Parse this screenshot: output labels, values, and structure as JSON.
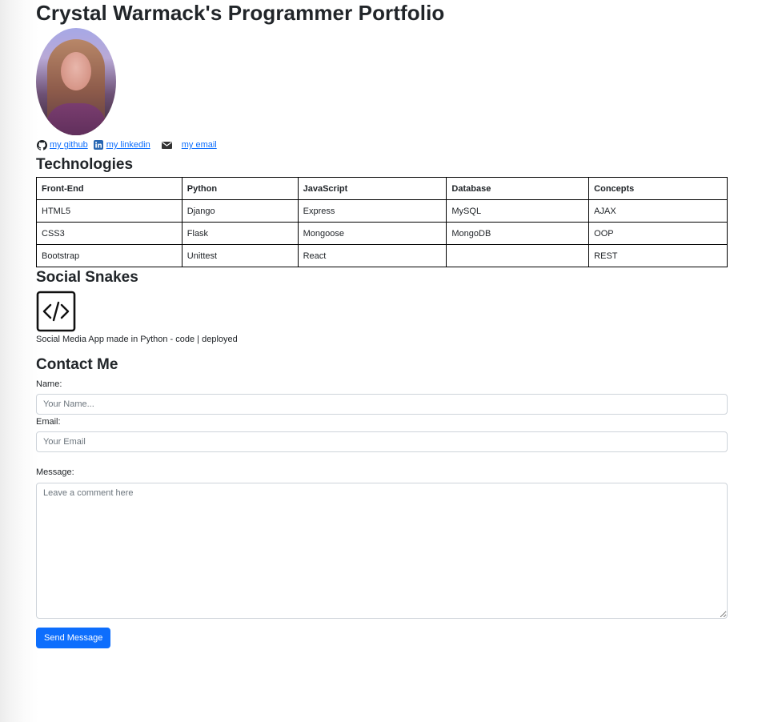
{
  "page": {
    "title": "Crystal Warmack's Programmer Portfolio"
  },
  "links": {
    "github": "my github",
    "linkedin": "my linkedin",
    "email": "my email"
  },
  "technologies": {
    "heading": "Technologies",
    "columns": [
      "Front-End",
      "Python",
      "JavaScript",
      "Database",
      "Concepts"
    ],
    "rows": [
      [
        "HTML5",
        "Django",
        "Express",
        "MySQL",
        "AJAX"
      ],
      [
        "CSS3",
        "Flask",
        "Mongoose",
        "MongoDB",
        "OOP"
      ],
      [
        "Bootstrap",
        "Unittest",
        "React",
        "",
        "REST"
      ]
    ]
  },
  "project": {
    "heading": "Social Snakes",
    "icon": "code-icon",
    "description": "Social Media App made in Python - code | deployed"
  },
  "contact": {
    "heading": "Contact Me",
    "name_label": "Name:",
    "name_placeholder": "Your Name...",
    "email_label": "Email:",
    "email_placeholder": "Your Email",
    "message_label": "Message:",
    "message_placeholder": "Leave a comment here",
    "submit_label": "Send Message"
  },
  "colors": {
    "link": "#0d6efd",
    "button": "#0d6efd",
    "text": "#212529"
  }
}
